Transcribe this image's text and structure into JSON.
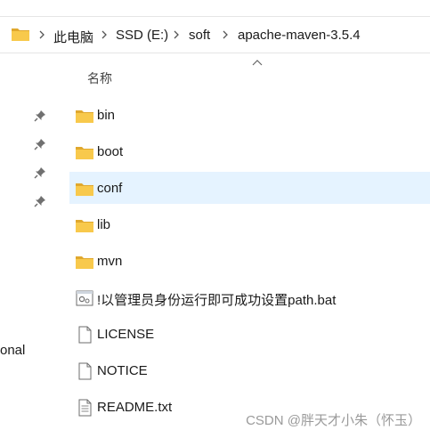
{
  "breadcrumb": {
    "items": [
      "此电脑",
      "SSD (E:)",
      "soft",
      "apache-maven-3.5.4"
    ]
  },
  "columns": {
    "name_header": "名称"
  },
  "left_pane": {
    "partial_label": "onal"
  },
  "files": [
    {
      "name": "bin",
      "type": "folder",
      "selected": false
    },
    {
      "name": "boot",
      "type": "folder",
      "selected": false
    },
    {
      "name": "conf",
      "type": "folder",
      "selected": true
    },
    {
      "name": "lib",
      "type": "folder",
      "selected": false
    },
    {
      "name": "mvn",
      "type": "folder",
      "selected": false
    },
    {
      "name": "!以管理员身份运行即可成功设置path.bat",
      "type": "batch-file",
      "selected": false
    },
    {
      "name": "LICENSE",
      "type": "file",
      "selected": false
    },
    {
      "name": "NOTICE",
      "type": "file",
      "selected": false
    },
    {
      "name": "README.txt",
      "type": "text-file",
      "selected": false
    }
  ],
  "watermark": "CSDN @胖天才小朱（怀玉）",
  "colors": {
    "folder": "#f8c94c",
    "folder_dark": "#e0a82e",
    "selection": "#e5f3ff"
  }
}
